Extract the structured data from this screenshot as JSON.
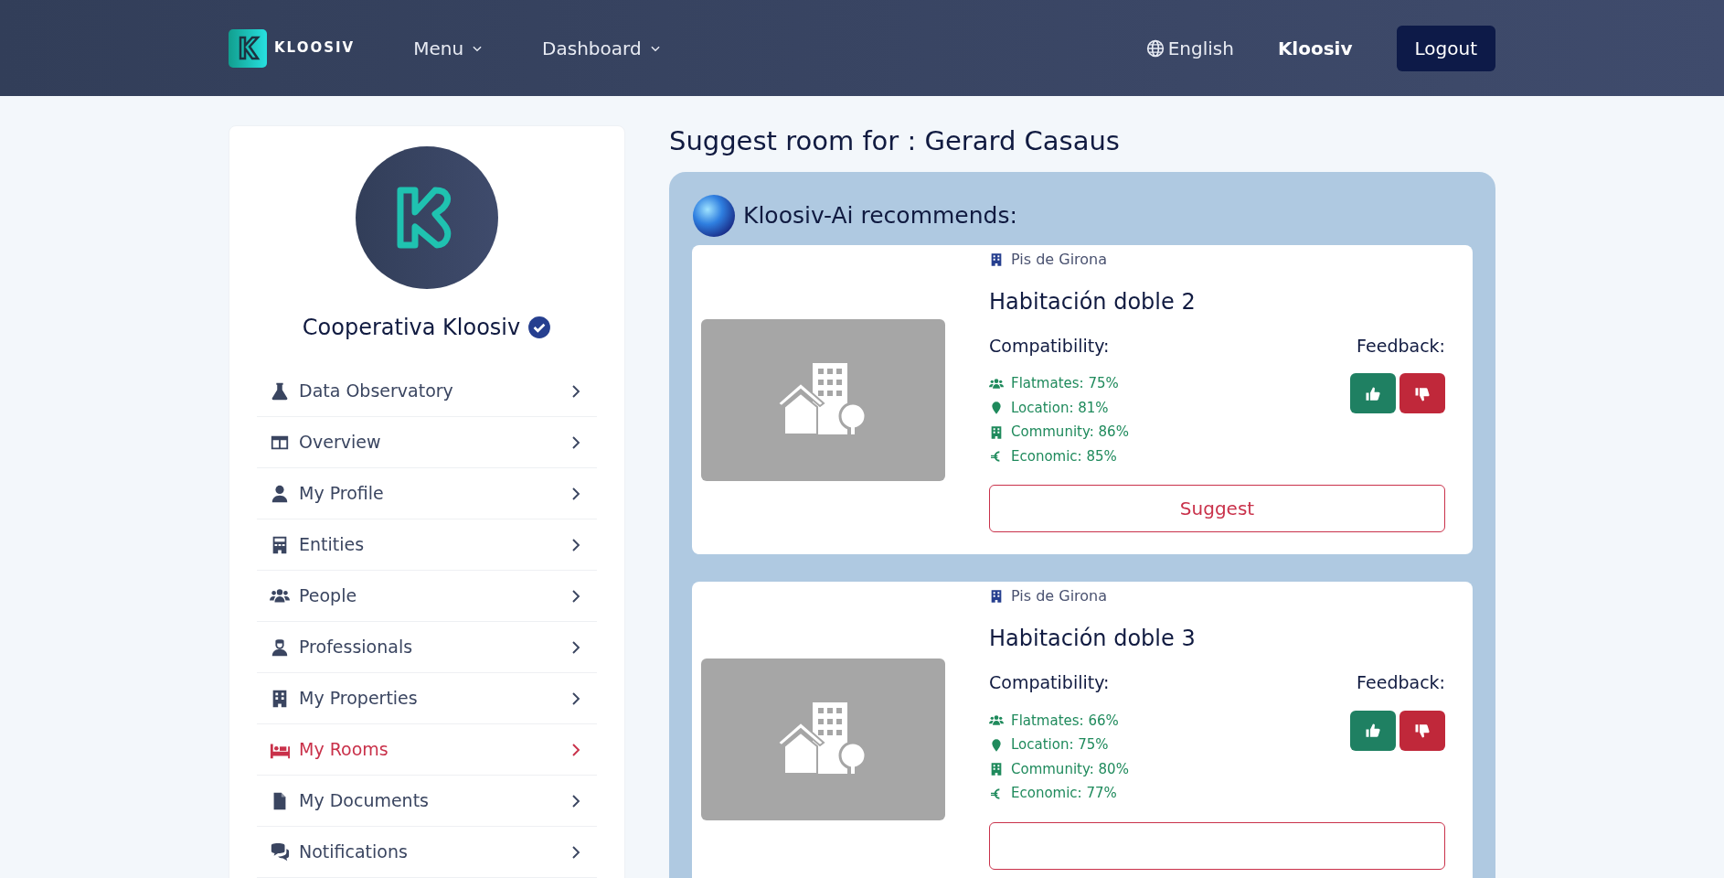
{
  "navbar": {
    "brand": "KLOOSIV",
    "menus": [
      {
        "label": "Menu"
      },
      {
        "label": "Dashboard"
      }
    ],
    "language": "English",
    "user": "Kloosiv",
    "logout": "Logout"
  },
  "sidebar": {
    "name": "Cooperativa Kloosiv",
    "verified": true,
    "items": [
      {
        "label": "Data Observatory",
        "selected": false
      },
      {
        "label": "Overview",
        "selected": false
      },
      {
        "label": "My Profile",
        "selected": false
      },
      {
        "label": "Entities",
        "selected": false
      },
      {
        "label": "People",
        "selected": false
      },
      {
        "label": "Professionals",
        "selected": false
      },
      {
        "label": "My Properties",
        "selected": false
      },
      {
        "label": "My Rooms",
        "selected": true
      },
      {
        "label": "My Documents",
        "selected": false
      },
      {
        "label": "Notifications",
        "selected": false
      }
    ]
  },
  "main": {
    "title": "Suggest room for : Gerard Casaus",
    "panel_title": "Kloosiv-Ai recommends:",
    "rooms": [
      {
        "property": "Pis de Girona",
        "name": "Habitación doble 2",
        "compatibility_label": "Compatibility:",
        "feedback_label": "Feedback:",
        "stats": [
          "Flatmates: 75%",
          "Location: 81%",
          "Community: 86%",
          "Economic: 85%"
        ],
        "suggest": "Suggest"
      },
      {
        "property": "Pis de Girona",
        "name": "Habitación doble 3",
        "compatibility_label": "Compatibility:",
        "feedback_label": "Feedback:",
        "stats": [
          "Flatmates: 66%",
          "Location: 75%",
          "Community: 80%",
          "Economic: 77%"
        ]
      }
    ]
  }
}
